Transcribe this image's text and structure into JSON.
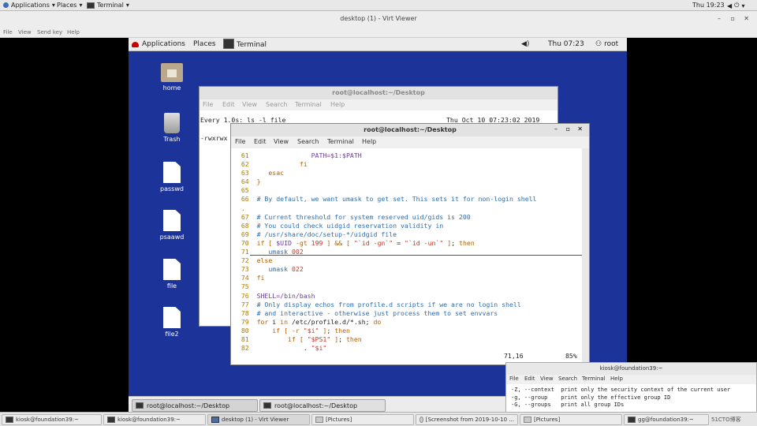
{
  "host_panel": {
    "applications": "Applications",
    "places": "Places",
    "terminal": "Terminal",
    "clock": "Thu 19:23"
  },
  "viewer": {
    "title": "desktop (1) - Virt Viewer",
    "menu": [
      "File",
      "View",
      "Send key",
      "Help"
    ]
  },
  "guest_panel": {
    "applications": "Applications",
    "places": "Places",
    "terminal": "Terminal",
    "clock": "Thu 07:23",
    "user": "root"
  },
  "desktop_icons": [
    "home",
    "Trash",
    "passwd",
    "psaawd",
    "file",
    "file2"
  ],
  "back_terminal": {
    "title": "root@localhost:~/Desktop",
    "menu": [
      "File",
      "Edit",
      "View",
      "Search",
      "Terminal",
      "Help"
    ],
    "watch_cmd": "Every 1.0s: ls -l file",
    "watch_time": "Thu Oct 10 07:23:02 2019",
    "output": "-rwxrwx"
  },
  "front_terminal": {
    "title": "root@localhost:~/Desktop",
    "menu": [
      "File",
      "Edit",
      "View",
      "Search",
      "Terminal",
      "Help"
    ],
    "status_pos": "71,16",
    "status_pct": "85%"
  },
  "guest_taskbar": {
    "task1": "root@localhost:~/Desktop",
    "task2": "root@localhost:~/Desktop"
  },
  "host_terminal": {
    "title": "kiosk@foundation39:~",
    "menu": [
      "File",
      "Edit",
      "View",
      "Search",
      "Terminal",
      "Help"
    ],
    "lines": [
      "-Z, --context  print only the security context of the current user",
      "-g, --group    print only the effective group ID",
      "-G, --groups   print all group IDs"
    ]
  },
  "host_taskbar": {
    "items": [
      "kiosk@foundation39:~",
      "kiosk@foundation39:~",
      "desktop (1) - Virt Viewer",
      "[Pictures]",
      "[Screenshot from 2019-10-10 ...",
      "[Pictures]",
      "gg@foundation39:~"
    ],
    "tray": "51CTO博客"
  }
}
